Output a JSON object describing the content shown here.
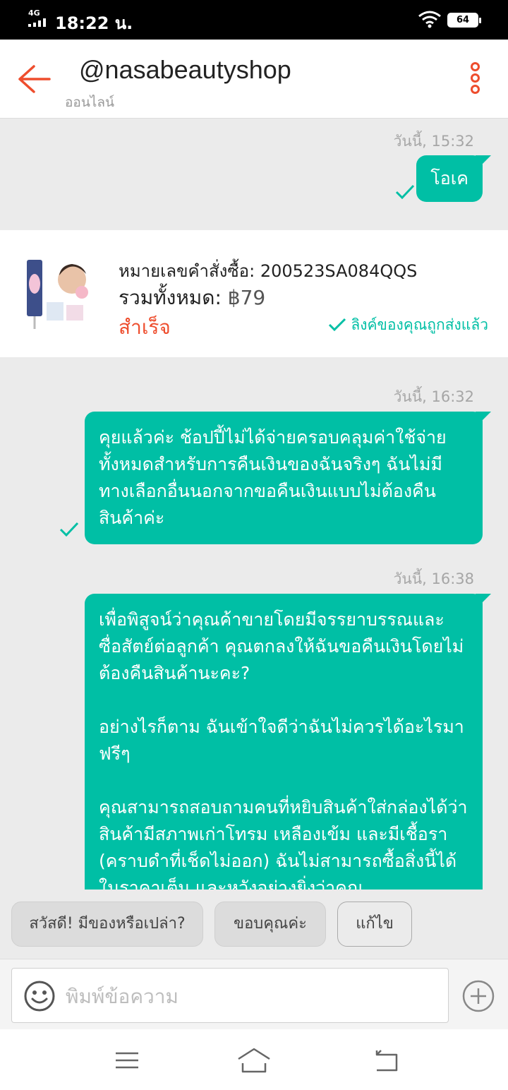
{
  "status_bar": {
    "network": "4G",
    "time": "18:22 น.",
    "battery": "64"
  },
  "header": {
    "title": "@nasabeautyshop",
    "status": "ออนไลน์"
  },
  "messages": [
    {
      "time": "วันนี้, 15:32",
      "paragraphs": [
        "โอเค"
      ]
    },
    {
      "time": "วันนี้, 16:32",
      "paragraphs": [
        "คุยแล้วค่ะ ช้อปปี้ไม่ได้จ่ายครอบคลุมค่าใช้จ่ายทั้งหมดสำหรับการคืนเงินของฉันจริงๆ ฉันไม่มีทางเลือกอื่นนอกจากขอคืนเงินแบบไม่ต้องคืนสินค้าค่ะ"
      ]
    },
    {
      "time": "วันนี้, 16:38",
      "paragraphs": [
        "เพื่อพิสูจน์ว่าคุณค้าขายโดยมีจรรยาบรรณและซื่อสัตย์ต่อลูกค้า คุณตกลงให้ฉันขอคืนเงินโดยไม่ต้องคืนสินค้านะคะ?",
        "อย่างไรก็ตาม ฉันเข้าใจดีว่าฉันไม่ควรได้อะไรมาฟรีๆ",
        "คุณสามารถสอบถามคนที่หยิบสินค้าใส่กล่องได้ว่าสินค้ามีสภาพเก่าโทรม เหลืองเข้ม และมีเชื้อรา (คราบดำที่เช็ดไม่ออก) ฉันไม่สามารถซื้อสิ่งนี้ได้ในราคาเต็ม และหวังอย่างยิ่งว่าคุณ"
      ]
    }
  ],
  "order": {
    "number_label": "หมายเลขคำสั่งซื้อ: 200523SA084QQS",
    "total_label": "รวมทั้งหมด:",
    "total_value": "฿79",
    "state": "สำเร็จ",
    "link_status": "ลิงค์ของคุณถูกส่งแล้ว"
  },
  "quick_replies": [
    "สวัสดี! มีของหรือเปล่า?",
    "ขอบคุณค่ะ",
    "แก้ไข"
  ],
  "composer": {
    "placeholder": "พิมพ์ข้อความ"
  },
  "colors": {
    "accent": "#ee4d2d",
    "bubble": "#00bfa5"
  }
}
